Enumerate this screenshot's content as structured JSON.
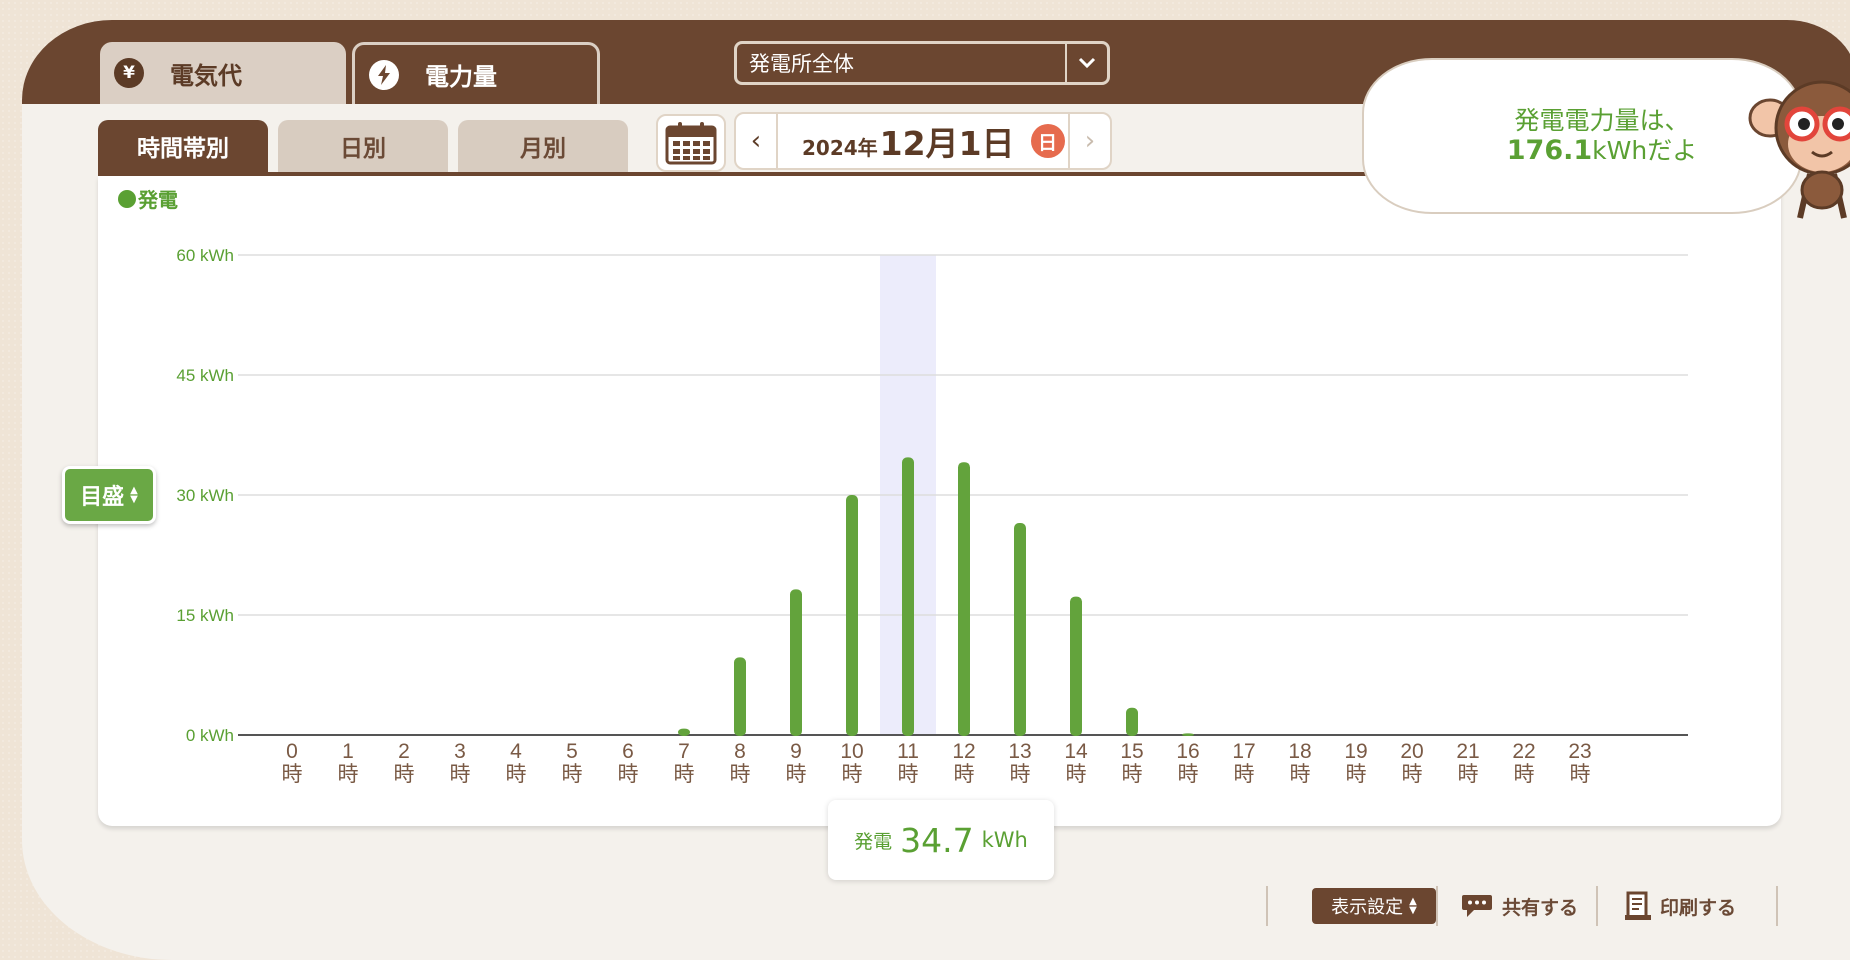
{
  "unit_tabs": {
    "yen": {
      "icon": "yen-icon",
      "icon_text": "¥",
      "label": "電気代"
    },
    "kwh": {
      "icon": "lightning-icon",
      "label": "電力量"
    }
  },
  "plant_select": {
    "value": "発電所全体"
  },
  "period_tabs": [
    "時間帯別",
    "日別",
    "月別"
  ],
  "date_nav": {
    "year": "2024年",
    "monthday": "12月1日",
    "weekday": "日",
    "prev": "‹",
    "next": "›"
  },
  "bubble": {
    "line1": "発電電力量は、",
    "value": "176.1",
    "suffix": "kWhだよ"
  },
  "scale_button": {
    "label": "目盛"
  },
  "tooltip": {
    "label": "発電",
    "value": "34.7",
    "unit": "kWh"
  },
  "footer": {
    "display_settings": "表示設定",
    "share": "共有する",
    "print": "印刷する"
  },
  "colors": {
    "brown": "#6b4630",
    "green": "#5aa033",
    "bar": "#63a33c",
    "highlight": "#ececfb"
  },
  "chart_data": {
    "type": "bar",
    "legend": "発電",
    "legend_position": "top-left",
    "ylim": [
      0,
      60
    ],
    "yticks": [
      "0 kWh",
      "15 kWh",
      "30 kWh",
      "45 kWh",
      "60 kWh"
    ],
    "ytick_values": [
      0,
      15,
      30,
      45,
      60
    ],
    "grid": true,
    "categories": [
      "0",
      "1",
      "2",
      "3",
      "4",
      "5",
      "6",
      "7",
      "8",
      "9",
      "10",
      "11",
      "12",
      "13",
      "14",
      "15",
      "16",
      "17",
      "18",
      "19",
      "20",
      "21",
      "22",
      "23"
    ],
    "category_suffix": "時",
    "series": [
      {
        "name": "発電",
        "values": [
          0,
          0,
          0,
          0,
          0,
          0,
          0,
          0.8,
          9.7,
          18.2,
          30.0,
          34.7,
          34.1,
          26.5,
          17.3,
          3.4,
          0.2,
          0,
          0,
          0,
          0,
          0,
          0,
          0
        ]
      }
    ],
    "highlighted_category": "11"
  }
}
